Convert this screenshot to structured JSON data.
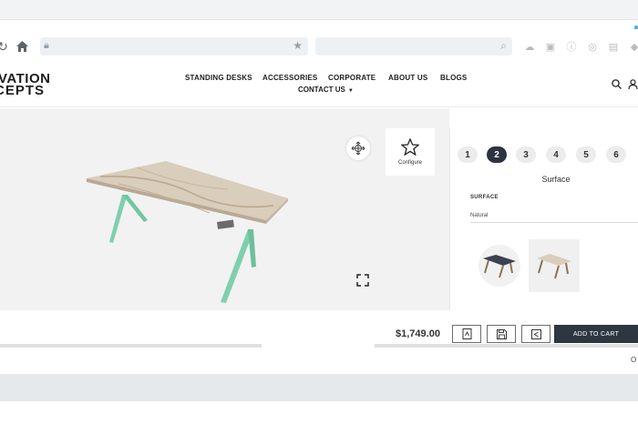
{
  "browser": {
    "icons": [
      "reload-icon",
      "home-icon",
      "lock-icon",
      "bookmark-star-icon",
      "search-icon",
      "cloud-icon",
      "camera-icon",
      "info-icon",
      "wifi-icon",
      "briefcase-icon",
      "shield-icon"
    ]
  },
  "header": {
    "logo_line1": "VATION",
    "logo_line2": "CEPTS",
    "nav": {
      "standing_desks": "STANDING DESKS",
      "accessories": "ACCESSORIES",
      "corporate": "CORPORATE",
      "about_us": "ABOUT US",
      "blogs": "BLOGS",
      "contact_us": "CONTACT US"
    },
    "accent_color": "#6cc7a0"
  },
  "viewer": {
    "configure_label": "Configure",
    "leg_color": "#7fcfad"
  },
  "configurator": {
    "steps": [
      "1",
      "2",
      "3",
      "4",
      "5",
      "6"
    ],
    "active_step": "2",
    "section_title": "Surface",
    "field_label": "SURFACE",
    "selected_surface": "Natural"
  },
  "action_bar": {
    "price": "$1,749.00",
    "add_to_cart": "ADD TO CART",
    "cut_text": "O",
    "button_color": "#2e3641"
  }
}
